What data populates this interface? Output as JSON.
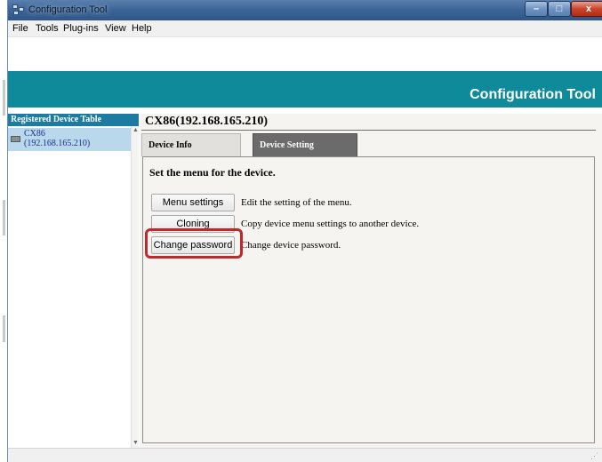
{
  "window": {
    "title": "Configuration Tool",
    "controls": {
      "minimize": "–",
      "maximize": "□",
      "close": "x"
    }
  },
  "menubar": [
    "File",
    "Tools",
    "Plug-ins",
    "View",
    "Help"
  ],
  "banner": {
    "title": "Configuration Tool"
  },
  "sidebar": {
    "header": "Registered Device Table",
    "devices": [
      {
        "name": "CX86",
        "ip": "(192.168.165.210)"
      }
    ],
    "scroll_up": "▲",
    "scroll_down": "▼"
  },
  "main": {
    "device_title": "CX86(192.168.165.210)",
    "tabs": [
      {
        "label": "Device Info",
        "active": false
      },
      {
        "label": "Device Setting",
        "active": true
      }
    ],
    "heading": "Set the menu for the device.",
    "actions": [
      {
        "button": "Menu settings",
        "description": "Edit the setting of the menu."
      },
      {
        "button": "Cloning",
        "description": "Copy device menu settings to another device."
      },
      {
        "button": "Change password",
        "description": "Change device password."
      }
    ]
  },
  "colors": {
    "banner": "#0f8a9b",
    "sidebar_header": "#1d7aa0",
    "selected_row": "#b9d8ec",
    "active_tab": "#6b6b6b",
    "highlight": "#c0282b"
  }
}
